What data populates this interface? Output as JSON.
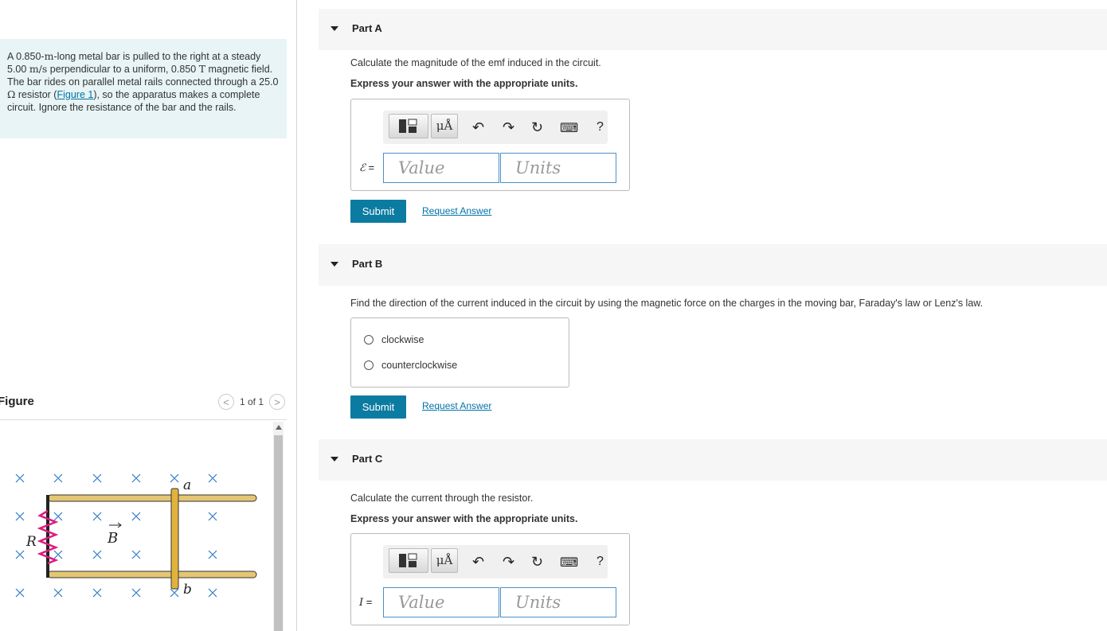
{
  "problem": {
    "t1": "A 0.850-",
    "u1": "m",
    "t2": "-long metal bar is pulled to the right at a steady 5.00 ",
    "u2": "m/s",
    "t3": " perpendicular to a uniform, 0.850 ",
    "u3": "T",
    "t4": " magnetic field. The bar rides on parallel metal rails connected through a 25.0 ",
    "u4": "Ω",
    "t5": " resistor (",
    "link": "Figure 1",
    "t6": "), so the apparatus makes a complete circuit. Ignore the resistance of the bar and the rails."
  },
  "figure": {
    "title": "Figure",
    "pager": "1 of 1",
    "prev": "<",
    "next": ">",
    "labels": {
      "a": "a",
      "b": "b",
      "R": "R",
      "B": "B"
    }
  },
  "partA": {
    "label": "Part A",
    "question": "Calculate the magnitude of the emf induced in the circuit.",
    "instruction": "Express your answer with the appropriate units.",
    "symbol": "ℰ",
    "eq": " =",
    "value_placeholder": "Value",
    "units_placeholder": "Units",
    "submit": "Submit",
    "request": "Request Answer"
  },
  "partB": {
    "label": "Part B",
    "question": "Find the direction of the current induced in the circuit by using the magnetic force on the charges in the moving bar, Faraday's law or Lenz's law.",
    "options": [
      "clockwise",
      "counterclockwise"
    ],
    "submit": "Submit",
    "request": "Request Answer"
  },
  "partC": {
    "label": "Part C",
    "question": "Calculate the current through the resistor.",
    "instruction": "Express your answer with the appropriate units.",
    "symbol": "I",
    "eq": " =",
    "value_placeholder": "Value",
    "units_placeholder": "Units"
  },
  "toolbar": {
    "mu": "μÅ",
    "undo": "↶",
    "redo": "↷",
    "reset": "↻",
    "keyboard": "⌨",
    "help": "?"
  },
  "colors": {
    "problem_bg": "#e8f4f5",
    "submit_bg": "#0c7ba1",
    "link": "#0073a8",
    "rail": "#e5c674",
    "bar": "#e2b33c",
    "resistor": "#e0197d",
    "field_x": "#2a78c8"
  }
}
